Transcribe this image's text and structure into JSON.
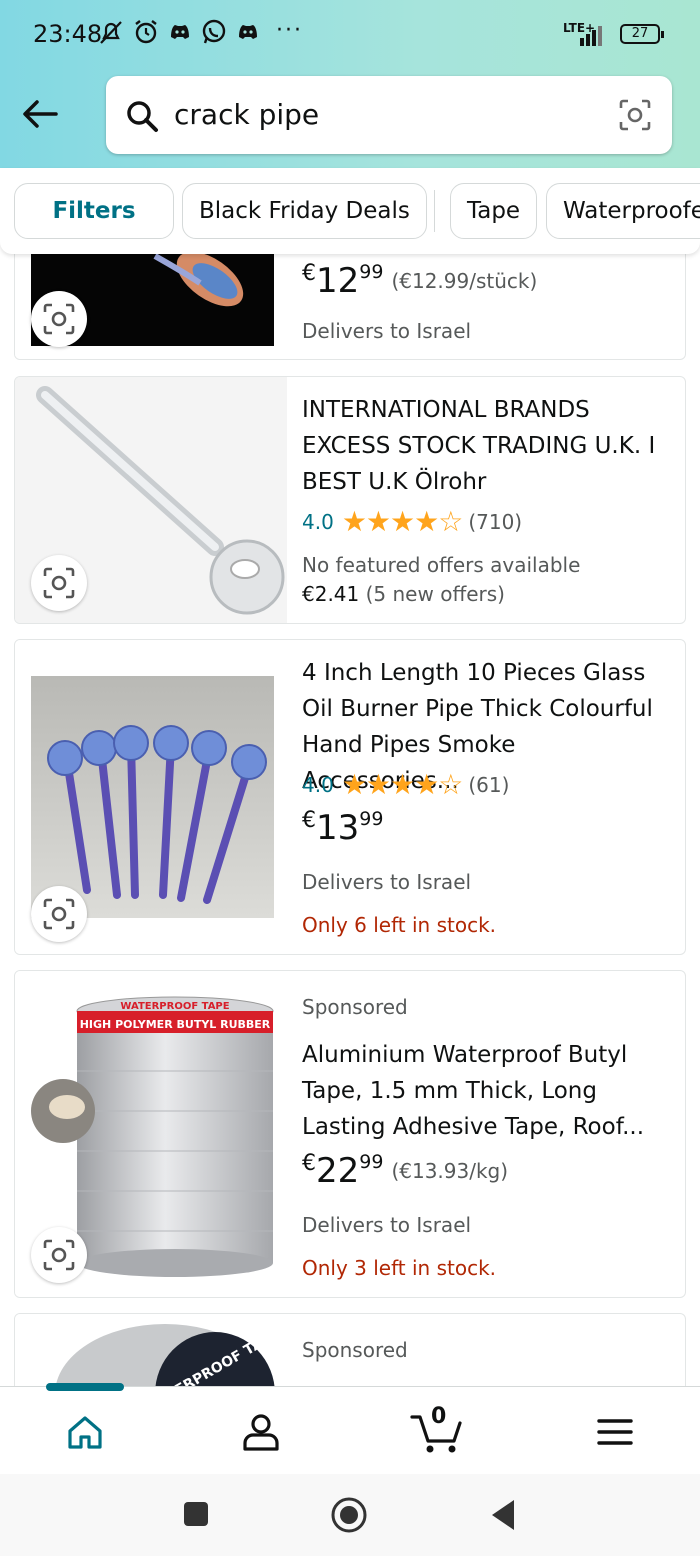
{
  "status": {
    "time": "23:48",
    "lte": "LTE+",
    "battery": "27"
  },
  "search": {
    "query": "crack pipe"
  },
  "chips": [
    "Filters",
    "Black Friday Deals",
    "Tape",
    "Waterproofe"
  ],
  "products": [
    {
      "price_currency": "€",
      "price_whole": "12",
      "price_fraction": "99",
      "unit_price": "(€12.99/stück)",
      "delivery": "Delivers to Israel"
    },
    {
      "title": "INTERNATIONAL BRANDS EXCESS STOCK TRADING U.K. I BEST U.K Ölrohr",
      "rating": "4.0",
      "stars": "★★★★☆",
      "reviews": "(710)",
      "no_offers": "No featured offers available",
      "offer_price": "€2.41",
      "offer_count": "(5 new offers)"
    },
    {
      "title": "4 Inch Length 10 Pieces Glass Oil Burner Pipe Thick Colourful Hand Pipes Smoke Accessories...",
      "rating": "4.0",
      "stars": "★★★★☆",
      "reviews": "(61)",
      "price_currency": "€",
      "price_whole": "13",
      "price_fraction": "99",
      "delivery": "Delivers to Israel",
      "stock": "Only 6 left in stock."
    },
    {
      "sponsored": "Sponsored",
      "image_text": "WATERPROOF TAPE",
      "image_subtext": "HIGH POLYMER BUTYL RUBBER",
      "title": "Aluminium Waterproof Butyl Tape, 1.5 mm Thick, Long Lasting Adhesive Tape, Roof...",
      "price_currency": "€",
      "price_whole": "22",
      "price_fraction": "99",
      "unit_price": "(€13.93/kg)",
      "delivery": "Delivers to Israel",
      "stock": "Only 3 left in stock."
    },
    {
      "sponsored": "Sponsored",
      "image_text": "WATERPROOF TAPE"
    }
  ],
  "nav": {
    "cart_count": "0"
  },
  "colors": {
    "accent": "#007185",
    "star": "#ffa41c",
    "stock": "#b12704"
  }
}
